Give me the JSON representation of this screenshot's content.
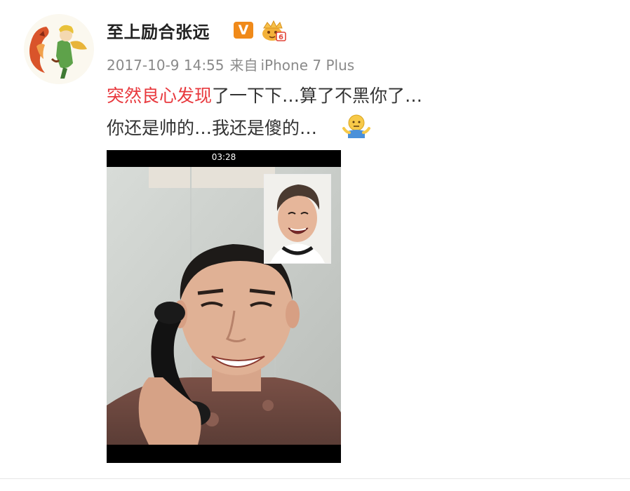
{
  "post": {
    "username": "至上励合张远",
    "verified_badge": "V",
    "timestamp": "2017-10-9 14:55",
    "source_prefix": "来自",
    "source_device": "iPhone 7 Plus",
    "topic": "突然良心发现",
    "line1_rest": "了一下下…算了不黑你了…",
    "line2": "你还是帅的…我还是傻的…",
    "emoji": "shrug-emoji"
  },
  "photo": {
    "call_timer": "03:28"
  },
  "colors": {
    "topic": "#e8383d",
    "meta": "#8a8a8a",
    "verified": "#f08a1a"
  }
}
